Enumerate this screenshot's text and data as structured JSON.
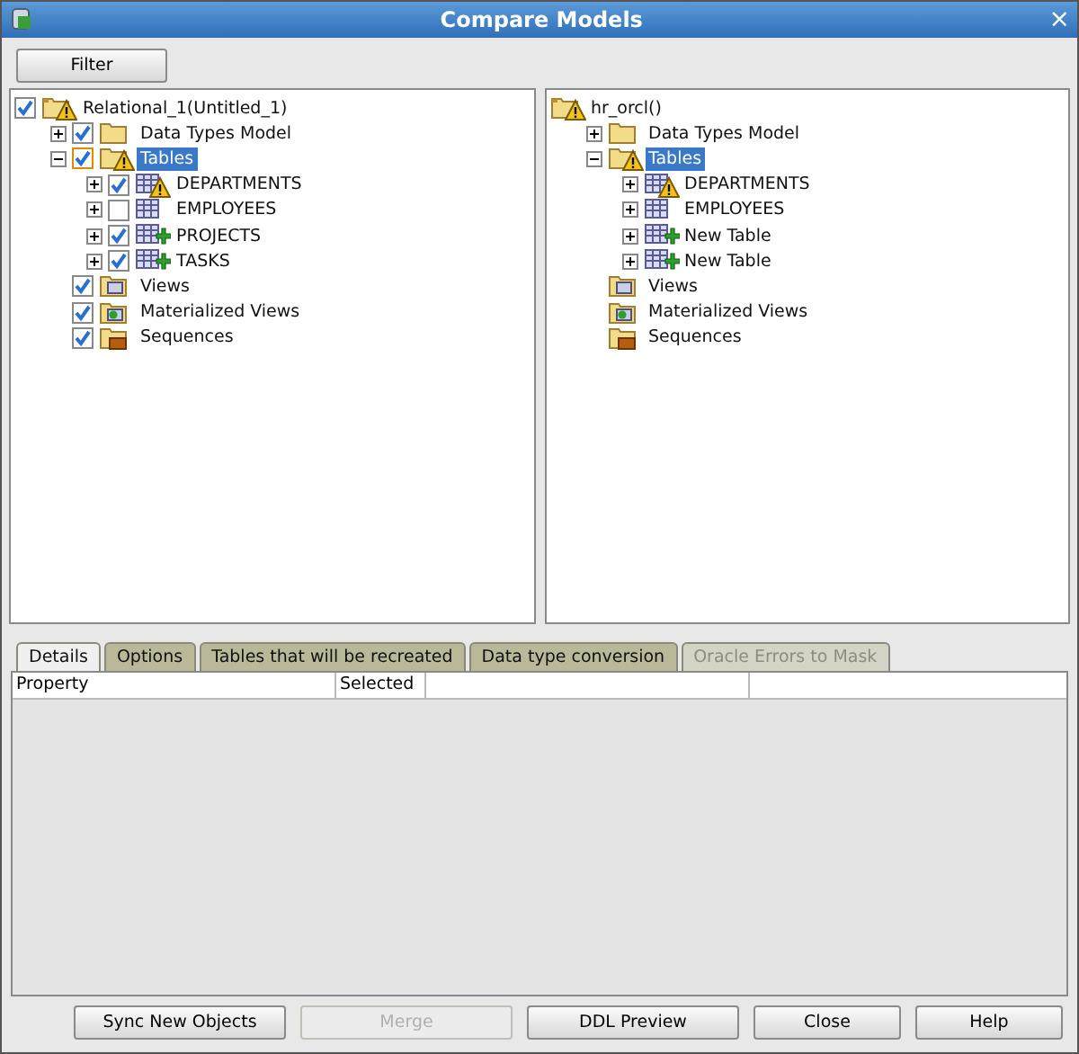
{
  "window": {
    "title": "Compare Models",
    "close": "×"
  },
  "filter_button": "Filter",
  "left_tree": {
    "label": "Relational_1(Untitled_1)",
    "kind": "model_warning",
    "checked": true,
    "selected": false,
    "children": [
      {
        "label": "Data Types Model",
        "kind": "folder",
        "checked": true,
        "selected": false,
        "expanded": false
      },
      {
        "label": "Tables",
        "kind": "folder_warning",
        "checked": true,
        "selected": true,
        "expanded": true,
        "children": [
          {
            "label": "DEPARTMENTS",
            "kind": "table_warning",
            "checked": true,
            "selected": false,
            "expanded": false
          },
          {
            "label": "EMPLOYEES",
            "kind": "table",
            "checked": false,
            "selected": false,
            "expanded": false
          },
          {
            "label": "PROJECTS",
            "kind": "table_new",
            "checked": true,
            "selected": false,
            "expanded": false
          },
          {
            "label": "TASKS",
            "kind": "table_new",
            "checked": true,
            "selected": false,
            "expanded": false
          }
        ]
      },
      {
        "label": "Views",
        "kind": "views",
        "checked": true,
        "selected": false
      },
      {
        "label": "Materialized Views",
        "kind": "mviews",
        "checked": true,
        "selected": false
      },
      {
        "label": "Sequences",
        "kind": "sequences",
        "checked": true,
        "selected": false
      }
    ]
  },
  "right_tree": {
    "label": "hr_orcl()",
    "kind": "model_warning",
    "selected": false,
    "children": [
      {
        "label": "Data Types Model",
        "kind": "folder",
        "selected": false,
        "expanded": false
      },
      {
        "label": "Tables",
        "kind": "folder_warning",
        "selected": true,
        "expanded": true,
        "children": [
          {
            "label": "DEPARTMENTS",
            "kind": "table_warning",
            "selected": false,
            "expanded": false
          },
          {
            "label": "EMPLOYEES",
            "kind": "table",
            "selected": false,
            "expanded": false
          },
          {
            "label": "New Table",
            "kind": "table_new",
            "selected": false,
            "expanded": false
          },
          {
            "label": "New Table",
            "kind": "table_new",
            "selected": false,
            "expanded": false
          }
        ]
      },
      {
        "label": "Views",
        "kind": "views",
        "selected": false
      },
      {
        "label": "Materialized Views",
        "kind": "mviews",
        "selected": false
      },
      {
        "label": "Sequences",
        "kind": "sequences",
        "selected": false
      }
    ]
  },
  "tabs": [
    {
      "label": "Details",
      "selected": true,
      "disabled": false
    },
    {
      "label": "Options",
      "selected": false,
      "disabled": false
    },
    {
      "label": "Tables that will be recreated",
      "selected": false,
      "disabled": false
    },
    {
      "label": "Data type conversion",
      "selected": false,
      "disabled": false
    },
    {
      "label": "Oracle Errors to Mask",
      "selected": false,
      "disabled": true
    }
  ],
  "table": {
    "columns": [
      "Property",
      "Selected"
    ]
  },
  "buttons": [
    {
      "label": "Sync New Objects",
      "disabled": false
    },
    {
      "label": "Merge",
      "disabled": true
    },
    {
      "label": "DDL Preview",
      "disabled": false
    },
    {
      "label": "Close",
      "disabled": false
    },
    {
      "label": "Help",
      "disabled": false
    }
  ]
}
